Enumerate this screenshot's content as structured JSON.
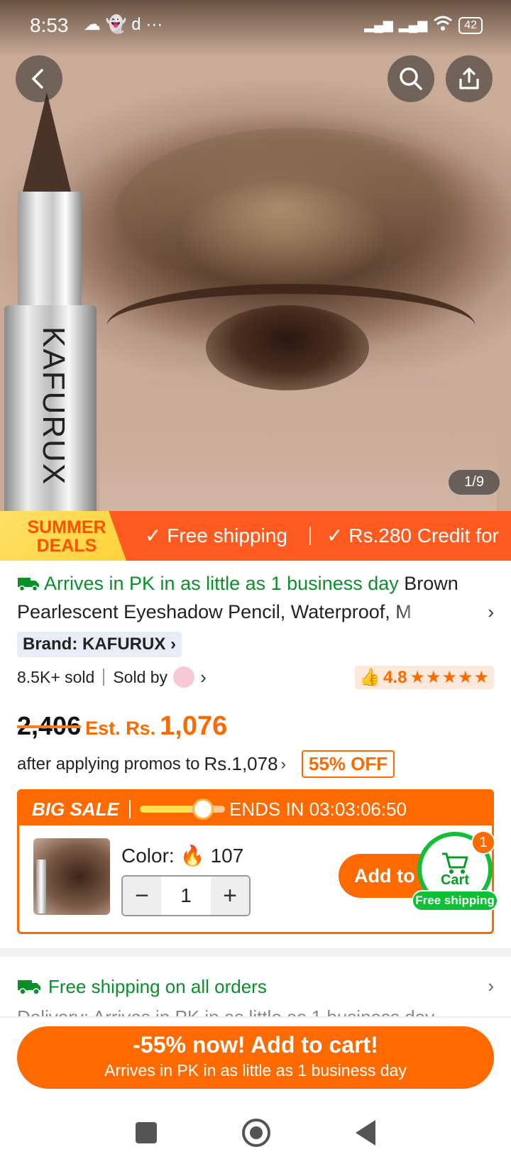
{
  "status_bar": {
    "time": "8:53",
    "left_icons": "☁ 👻 d ···",
    "battery": "42"
  },
  "hero": {
    "image_counter": "1/9",
    "pencil_brand": "KAFURUX"
  },
  "promo_bar": {
    "badge_line1": "SUMMER",
    "badge_line2": "DEALS",
    "perk1": "✓ Free shipping",
    "perk2": "✓ Rs.280 Credit for"
  },
  "product": {
    "arrival_highlight": "Arrives in PK in as little as 1 business day",
    "title_rest": " Brown",
    "title_line2": "Pearlescent Eyeshadow Pencil, Waterproof, M",
    "brand": "Brand: KAFURUX",
    "sold": "8.5K+ sold",
    "sold_by": "Sold by",
    "rating": "4.8",
    "stars": "★★★★★"
  },
  "price": {
    "old": "2,406",
    "est_label": "Est. Rs.",
    "current": "1,076",
    "promo_prefix": "after applying promos to",
    "promo_value": "Rs.1,078",
    "discount": "55% OFF"
  },
  "sale": {
    "label": "BIG SALE",
    "ends": "ENDS IN 03:03:06:50",
    "progress": 0.6,
    "color_label": "Color:",
    "color_count": "107",
    "quantity": "1",
    "minus": "−",
    "plus": "+",
    "add_button": "Add to cart"
  },
  "cart": {
    "label": "Cart",
    "count": "1",
    "free_shipping": "Free shipping"
  },
  "shipping": {
    "text": "Free shipping on all orders",
    "peek": "Delivery: Arrives in PK in as little as 1 business day"
  },
  "cta": {
    "line1": "-55% now! Add to cart!",
    "line2": "Arrives in PK in as little as 1 business day"
  },
  "colors": {
    "accent": "#ff6a00",
    "green": "#0a8f2a",
    "cart_green": "#0fbf35"
  }
}
